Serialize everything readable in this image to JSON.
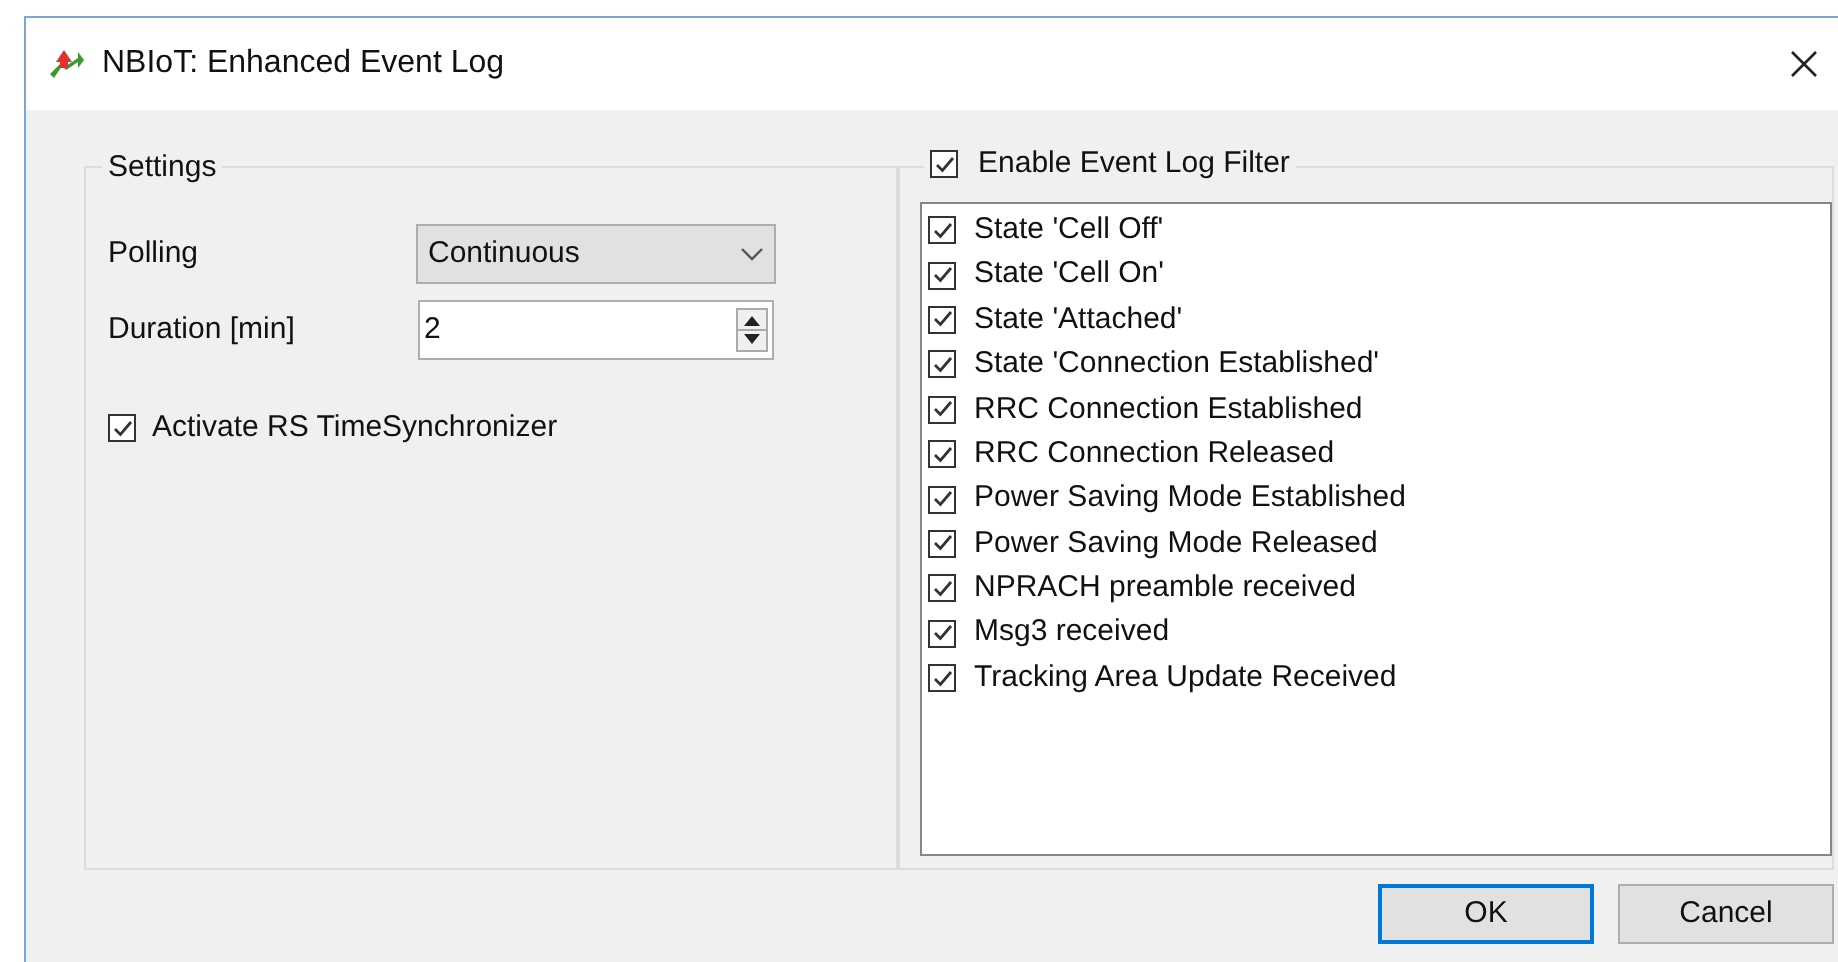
{
  "window": {
    "title": "NBIoT: Enhanced Event Log"
  },
  "settings": {
    "title": "Settings",
    "polling": {
      "label": "Polling",
      "value": "Continuous"
    },
    "duration": {
      "label": "Duration [min]",
      "value": "2"
    },
    "sync": {
      "label": "Activate RS TimeSynchronizer",
      "checked": true
    }
  },
  "filter": {
    "label": "Enable Event Log Filter",
    "checked": true,
    "items": [
      {
        "label": "State 'Cell Off'",
        "checked": true
      },
      {
        "label": "State 'Cell On'",
        "checked": true
      },
      {
        "label": "State 'Attached'",
        "checked": true
      },
      {
        "label": "State 'Connection Established'",
        "checked": true
      },
      {
        "label": "RRC Connection Established",
        "checked": true
      },
      {
        "label": "RRC Connection Released",
        "checked": true
      },
      {
        "label": "Power Saving Mode Established",
        "checked": true
      },
      {
        "label": "Power Saving Mode Released",
        "checked": true
      },
      {
        "label": "NPRACH preamble received",
        "checked": true
      },
      {
        "label": "Msg3 received",
        "checked": true
      },
      {
        "label": "Tracking Area Update Received",
        "checked": true
      }
    ]
  },
  "buttons": [
    {
      "label": "OK",
      "default": true
    },
    {
      "label": "Cancel",
      "default": false
    }
  ]
}
